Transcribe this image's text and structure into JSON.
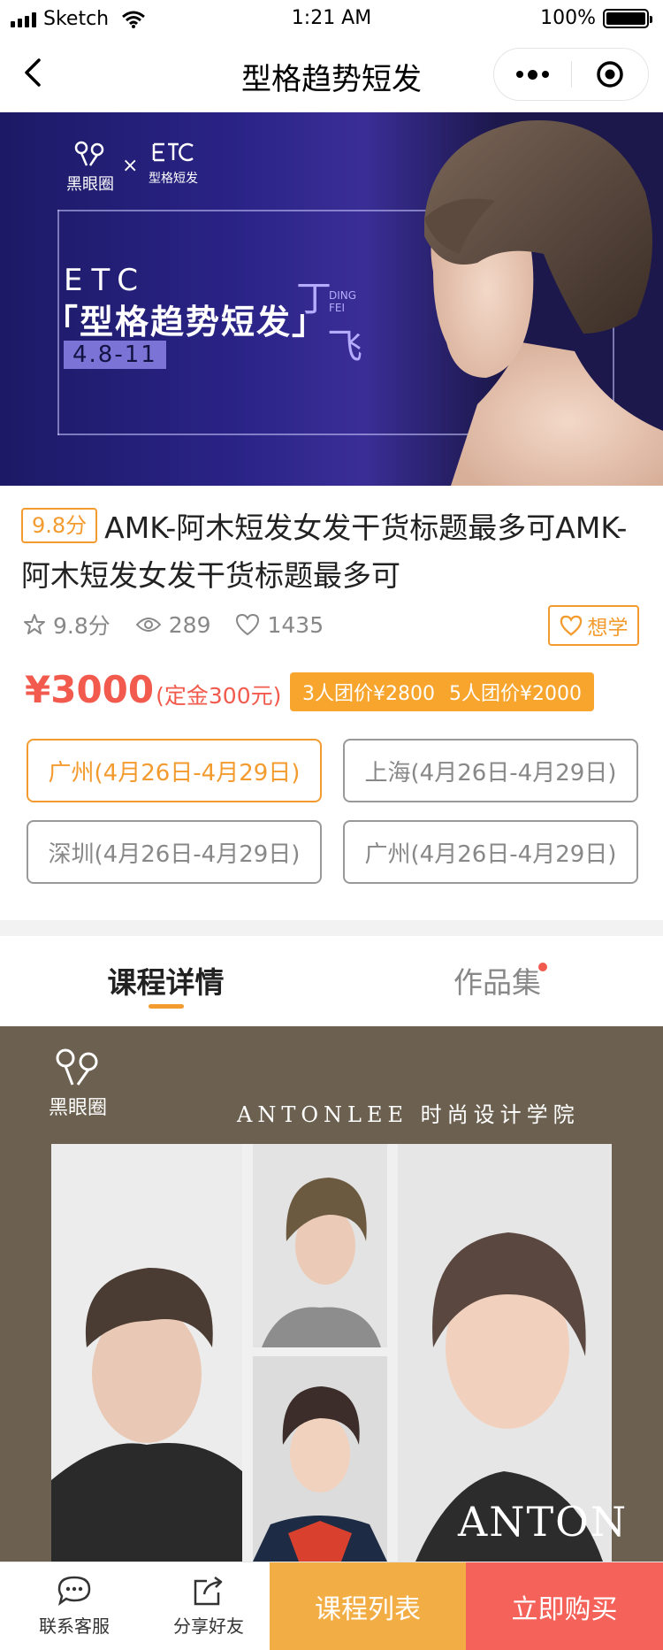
{
  "status_bar": {
    "carrier": "Sketch",
    "time": "1:21 AM",
    "battery": "100%",
    "battery_level": 1.0
  },
  "nav": {
    "title": "型格趋势短发",
    "icons": {
      "back": "chevron-left-icon",
      "more": "more-dots-icon",
      "close": "target-circle-icon"
    }
  },
  "banner": {
    "logo_a": "黑眼圈",
    "cross": "×",
    "logo_b": "型格短发",
    "etc": "ETC",
    "headline": "「型格趋势短发」",
    "date": "4.8-11",
    "name_cn_1": "丁",
    "name_cn_2": "飞",
    "name_en": "DING FEI"
  },
  "course": {
    "score_badge": "9.8分",
    "title": "AMK-阿木短发女发干货标题最多可AMK-阿木短发女发干货标题最多可"
  },
  "stats": {
    "rating": "9.8分",
    "views": "289",
    "likes": "1435"
  },
  "want_button": "想学",
  "price": {
    "amount": "¥3000",
    "deposit": "(定金300元)",
    "group_3": "3人团价¥2800",
    "group_5": "5人团价¥2000"
  },
  "sessions": [
    {
      "label": "广州(4月26日-4月29日)",
      "selected": true
    },
    {
      "label": "上海(4月26日-4月29日)",
      "selected": false
    },
    {
      "label": "深圳(4月26日-4月29日)",
      "selected": false
    },
    {
      "label": "广州(4月26日-4月29日)",
      "selected": false
    }
  ],
  "tabs": [
    {
      "label": "课程详情",
      "active": true
    },
    {
      "label": "作品集",
      "active": false,
      "has_dot": true
    }
  ],
  "poster": {
    "logo": "黑眼圈",
    "header": "ANTONLEE 时尚设计学院",
    "watermark": "ANTON"
  },
  "bottom_bar": {
    "service": "联系客服",
    "share": "分享好友",
    "course_list": "课程列表",
    "buy_now": "立即购买"
  },
  "colors": {
    "accent_orange": "#f39b2e",
    "price_red": "#f25a4d",
    "list_button": "#f2ae45",
    "buy_button": "#f4625a"
  }
}
